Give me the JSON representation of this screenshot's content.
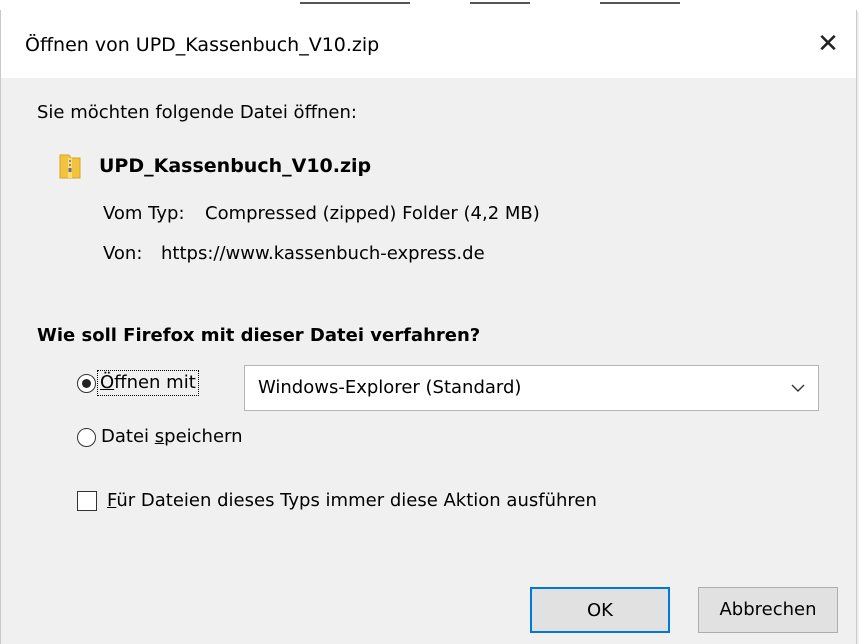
{
  "dialog": {
    "title": "Öffnen von UPD_Kassenbuch_V10.zip",
    "close_symbol": "✕",
    "lead_text": "Sie möchten folgende Datei öffnen:",
    "file_name": "UPD_Kassenbuch_V10.zip",
    "file_icon": "zip-folder-icon",
    "type_label": "Vom Typ:",
    "type_value": "Compressed (zipped) Folder (4,2 MB)",
    "from_label": "Von:",
    "from_value": "https://www.kassenbuch-express.de",
    "question": "Wie soll Firefox mit dieser Datei verfahren?",
    "open_with": {
      "label_underlined": "Ö",
      "label_rest": "ffnen mit",
      "selected": true,
      "app": "Windows-Explorer (Standard)"
    },
    "save_file": {
      "label_before": "Datei ",
      "label_underlined": "s",
      "label_after": "peichern",
      "selected": false
    },
    "always_action": {
      "label_underlined": "F",
      "label_rest": "ür Dateien dieses Typs immer diese Aktion ausführen",
      "checked": false
    },
    "ok_label": "OK",
    "cancel_label": "Abbrechen"
  },
  "colors": {
    "dialog_bg": "#f0f0f0",
    "title_bg": "#ffffff",
    "default_button_border": "#0078d7",
    "button_bg": "#e1e1e1",
    "zip_icon_yellow": "#f3c23e"
  }
}
